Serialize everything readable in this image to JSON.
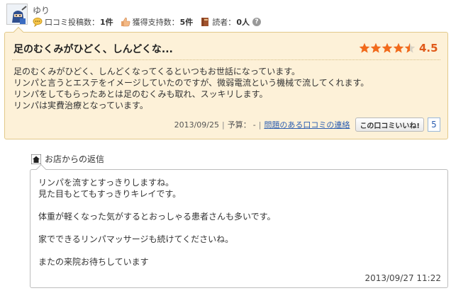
{
  "reviewer": {
    "name": "ゆり",
    "stats": {
      "posts_label": "口コミ投稿数：",
      "posts_value": "1件",
      "support_label": "獲得支持数：",
      "support_value": "5件",
      "readers_label": "読者：",
      "readers_value": "0人",
      "help_icon_text": "?"
    }
  },
  "review": {
    "title": "足のむくみがひどく、しんどくな...",
    "rating": 4.5,
    "score_text": "4.5",
    "body_lines": [
      "足のむくみがひどく、しんどくなってくるといつもお世話になっています。",
      "リンパと言うとエステをイメージしていたのですが、微弱電流という機械で流してくれます。",
      "リンパをしてもらったあとは足のむくみも取れ、スッキリします。",
      "リンパは実費治療となっています。"
    ],
    "date": "2013/09/25",
    "separator": "|",
    "budget_label": "予算：",
    "budget_value": "-",
    "report_link": "問題のある口コミの連絡",
    "like_button": "この口コミいいね!",
    "like_count": "5"
  },
  "reply": {
    "header": "お店からの返信",
    "lines": [
      "リンパを流すとすっきりしますね。",
      "見た目もとてもすっきりキレイです。",
      "",
      "体重が軽くなった気がするとおっしゃる患者さんも多いです。",
      "",
      "家でできるリンパマッサージも続けてくださいね。",
      "",
      "またの来院お待ちしています"
    ],
    "date": "2013/09/27 11:22"
  },
  "colors": {
    "star": "#f26a1b",
    "score": "#e05a1a",
    "review_bg": "#fdf1d8",
    "link": "#2a5db0"
  },
  "icons": {
    "avatar": "ninja-avatar",
    "posts": "speech-bubble-icon",
    "support": "thumbs-up-icon",
    "readers": "book-icon",
    "reply": "home-icon"
  }
}
